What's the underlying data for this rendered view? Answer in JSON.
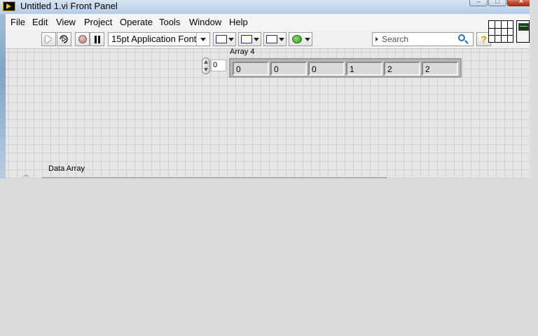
{
  "window": {
    "title": "Untitled 1.vi Front Panel",
    "close_glyph": "×",
    "min_glyph": "–",
    "max_glyph": "□"
  },
  "menu": [
    "File",
    "Edit",
    "View",
    "Project",
    "Operate",
    "Tools",
    "Window",
    "Help"
  ],
  "toolbar": {
    "font_label": "15pt Application Font",
    "search_placeholder": "Search",
    "help_label": "?",
    "icons": [
      "run-arrow-icon",
      "run-continuously-icon",
      "abort-icon",
      "pause-icon",
      "align-objects-icon",
      "distribute-objects-icon",
      "resize-objects-icon",
      "reorder-icon",
      "search-icon",
      "help-icon"
    ]
  },
  "panel": {
    "array4": {
      "label": "Array 4",
      "index": "0",
      "values": [
        "0",
        "0",
        "0",
        "1",
        "2",
        "2"
      ]
    },
    "data_array": {
      "label": "Data Array"
    }
  },
  "colors": {
    "titlebar": "#c3d7ec",
    "panel_background": "#e6e6e6",
    "grid": "#d0d0d0",
    "close_button": "#c9472d"
  }
}
